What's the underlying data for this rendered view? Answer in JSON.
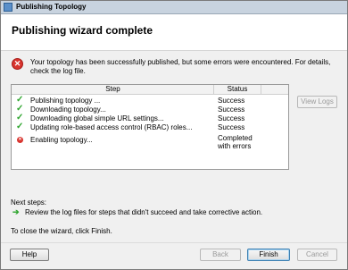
{
  "window": {
    "title": "Publishing Topology"
  },
  "header": {
    "heading": "Publishing wizard complete"
  },
  "summary": {
    "icon": "error-icon",
    "text": "Your topology has been successfully published, but some errors were encountered. For details, check the log file."
  },
  "steps_table": {
    "columns": [
      "Step",
      "Status"
    ],
    "rows": [
      {
        "icon": "success-check-icon",
        "step": "Publishing topology ...",
        "status": "Success"
      },
      {
        "icon": "success-check-icon",
        "step": "Downloading topology...",
        "status": "Success"
      },
      {
        "icon": "success-check-icon",
        "step": "Downloading global simple URL settings...",
        "status": "Success"
      },
      {
        "icon": "success-check-icon",
        "step": "Updating role-based access control (RBAC) roles...",
        "status": "Success"
      },
      {
        "icon": "error-icon",
        "step": "Enabling topology...",
        "status": "Completed with errors"
      }
    ]
  },
  "buttons": {
    "view_logs": "View Logs",
    "help": "Help",
    "back": "Back",
    "finish": "Finish",
    "cancel": "Cancel"
  },
  "next_steps": {
    "label": "Next steps:",
    "item": "Review the log files for steps that didn't succeed and take corrective action.",
    "icon": "green-arrow-icon"
  },
  "close_hint": "To close the wizard, click Finish.",
  "colors": {
    "success": "#2ea52e",
    "error": "#d8342e"
  }
}
